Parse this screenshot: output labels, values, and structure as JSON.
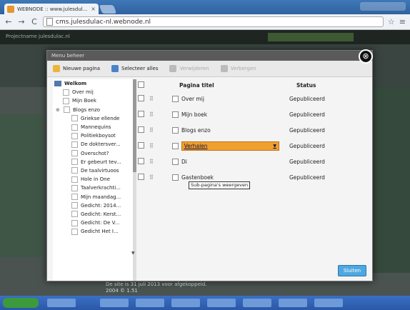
{
  "browser": {
    "tab_title": "WEBNODE :: www.julesdul...",
    "tab_close": "×",
    "back": "←",
    "forward": "→",
    "reload": "C",
    "address": "cms.julesdulac-nl.webnode.nl",
    "star": "☆",
    "menu": "≡"
  },
  "cms": {
    "site_url": "Projectname julesdulac.nl",
    "footer_line1": "De site is 31 juli 2013 voor afgekoppeld.",
    "footer_line2": "2004 © 1.51"
  },
  "modal": {
    "header": "Menu beheer",
    "close": "⊗",
    "toolbar": {
      "new_page": "Nieuwe pagina",
      "select_all": "Selecteer alles",
      "delete": "Verwijderen",
      "publish": "Verbergen"
    },
    "sidebar": {
      "root": "Welkom",
      "items": [
        "Over mij",
        "Mijn Boek",
        "Blogs enzo",
        "Griekse ellende",
        "Mannequins",
        "Politiekboysot",
        "De doktersver...",
        "Overschot?",
        "Er gebeurt tev...",
        "De taalvirtuoos",
        "Hole in One",
        "Taalverkrachti...",
        "Mijn maandag...",
        "Gedicht: 2014...",
        "Gedicht: Kerst...",
        "Gedicht: De V...",
        "Gedicht Het I..."
      ]
    },
    "table": {
      "col_title": "Pagina titel",
      "col_status": "Status",
      "rows": [
        {
          "title": "Over mij",
          "status": "Gepubliceerd"
        },
        {
          "title": "Mijn boek",
          "status": "Gepubliceerd"
        },
        {
          "title": "Blogs enzo",
          "status": "Gepubliceerd"
        },
        {
          "title": "Verhalen",
          "status": "Gepubliceerd",
          "selected": true
        },
        {
          "title": "Di",
          "status": "Gepubliceerd"
        },
        {
          "title": "Gastenboek",
          "status": "Gepubliceerd"
        }
      ]
    },
    "tooltip": "Sub-pagina's weergeven",
    "close_button": "Sluiten"
  },
  "colors": {
    "selected_field": "#f0a030",
    "button_blue": "#4ea8e0"
  }
}
